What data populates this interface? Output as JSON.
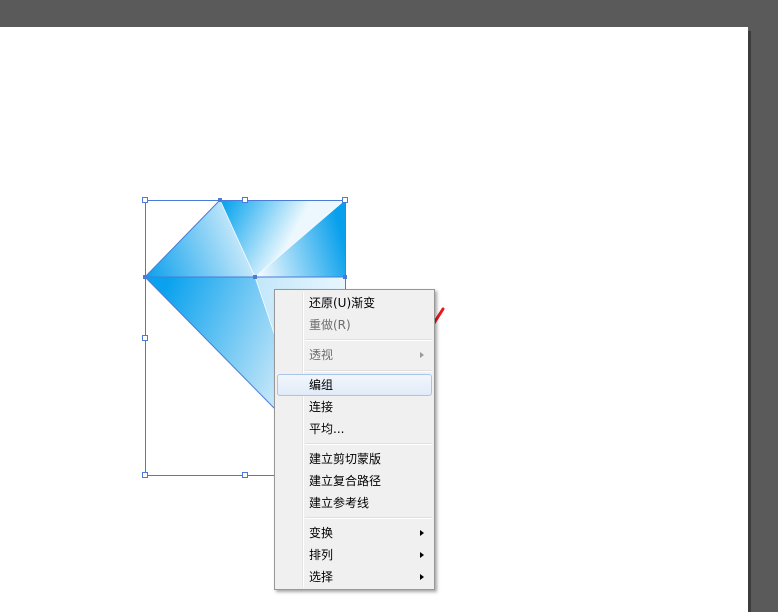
{
  "context_menu": {
    "items": [
      {
        "label": "还原(U)渐变",
        "enabled": true
      },
      {
        "label": "重做(R)",
        "enabled": false
      },
      {
        "label": "透视",
        "enabled": false,
        "submenu": true
      },
      {
        "label": "编组",
        "enabled": true,
        "highlighted": true
      },
      {
        "label": "连接",
        "enabled": true
      },
      {
        "label": "平均...",
        "enabled": true
      },
      {
        "label": "建立剪切蒙版",
        "enabled": true
      },
      {
        "label": "建立复合路径",
        "enabled": true
      },
      {
        "label": "建立参考线",
        "enabled": true
      },
      {
        "label": "变换",
        "enabled": true,
        "submenu": true
      },
      {
        "label": "排列",
        "enabled": true,
        "submenu": true
      },
      {
        "label": "选择",
        "enabled": true,
        "submenu": true
      }
    ]
  },
  "colors": {
    "workspace": "#5a5a5a",
    "artboard": "#ffffff",
    "selection": "#4a7bd6",
    "gradient_dark": "#0aa0ec",
    "gradient_light": "#e4f4fc",
    "annotation_arrow": "#e8181a"
  }
}
